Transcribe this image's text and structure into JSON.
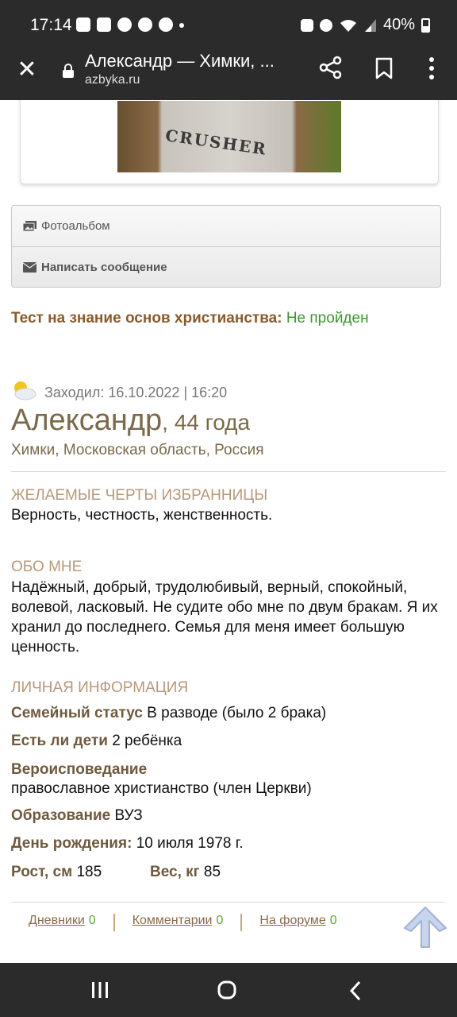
{
  "status_bar": {
    "time": "17:14",
    "battery": "40%",
    "icons": [
      "message-icon",
      "pay-icon",
      "settings-icon",
      "account-icon",
      "one-icon",
      "dot",
      "recycle-icon",
      "alarm-icon",
      "wifi-icon",
      "signal-icon",
      "battery-icon"
    ]
  },
  "browser": {
    "title": "Александр — Химки, ...",
    "url": "azbyka.ru"
  },
  "photo": {
    "shirt_text": "CRUSHER"
  },
  "actions": {
    "album": "Фотоальбом",
    "message": "Написать сообщение"
  },
  "test": {
    "label": "Тест на знание основ христианства:",
    "value": "Не пройден"
  },
  "profile": {
    "last_visit": "Заходил: 16.10.2022 | 16:20",
    "name": "Александр",
    "age": ", 44 года",
    "location": "Химки, Московская область, Россия"
  },
  "partner_traits": {
    "heading": "ЖЕЛАЕМЫЕ ЧЕРТЫ ИЗБРАННИЦЫ",
    "text": "Верность, честность, женственность."
  },
  "about": {
    "heading": "ОБО МНЕ",
    "text": "Надёжный, добрый, трудолюбивый, верный, спокойный, волевой, ласковый. Не судите обо мне по двум бракам. Я их хранил до последнего. Семья для меня имеет большую ценность."
  },
  "personal": {
    "heading": "ЛИЧНАЯ ИНФОРМАЦИЯ",
    "marital_label": "Семейный статус",
    "marital_value": "В разводе (было 2 брака)",
    "children_label": "Есть ли дети",
    "children_value": "2 ребёнка",
    "religion_label": "Вероисповедание",
    "religion_value": "православное христианство (член Церкви)",
    "education_label": "Образование",
    "education_value": "ВУЗ",
    "birthday_label": "День рождения:",
    "birthday_value": "10 июля 1978 г.",
    "height_label": "Рост, см",
    "height_value": "185",
    "weight_label": "Вес, кг",
    "weight_value": "85"
  },
  "footer": {
    "diaries": "Дневники",
    "diaries_count": "0",
    "comments": "Комментарии",
    "comments_count": "0",
    "forum": "На форуме",
    "forum_count": "0"
  },
  "colors": {
    "brown": "#8b5a2b",
    "green": "#3a9a2a",
    "section_heading": "#b89878",
    "bar": "#2b2b2b"
  }
}
